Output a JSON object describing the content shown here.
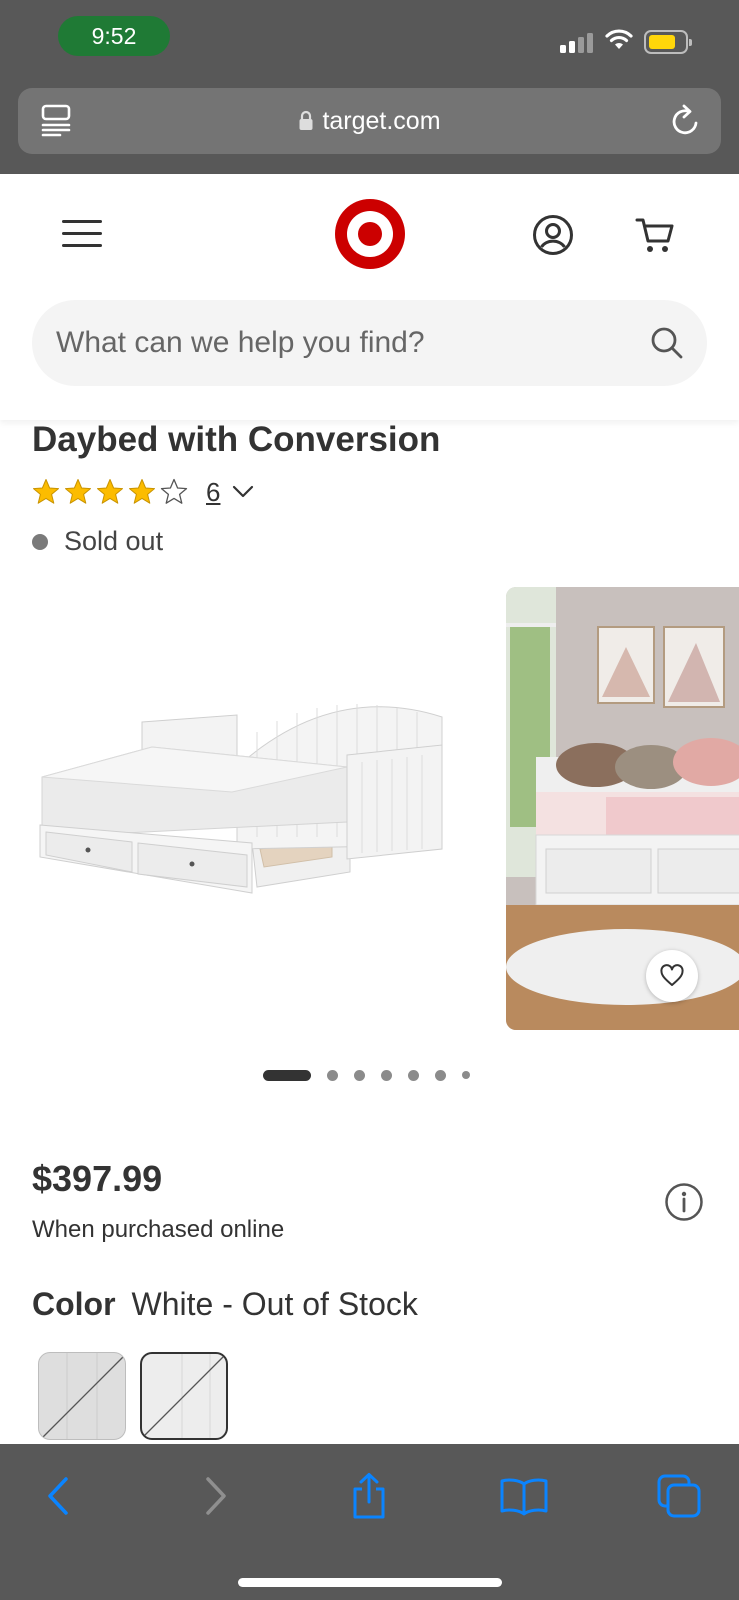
{
  "status_bar": {
    "time": "9:52"
  },
  "browser": {
    "url": "target.com"
  },
  "header": {
    "search_placeholder": "What can we help you find?"
  },
  "product": {
    "title": "Daybed with Conversion",
    "rating": 4,
    "rating_max": 5,
    "review_count": "6",
    "stock_status": "Sold out",
    "price": "$397.99",
    "price_note": "When purchased online",
    "color_label": "Color",
    "color_value": "White - Out of Stock",
    "swatches_count": 2,
    "selected_swatch": 2
  },
  "gallery": {
    "image_count": 7,
    "active_image": 1
  },
  "colors": {
    "brand_red": "#cc0000",
    "chrome_gray": "#585858",
    "safari_blue": "#0a84ff",
    "star_gold": "#fcbc00"
  }
}
